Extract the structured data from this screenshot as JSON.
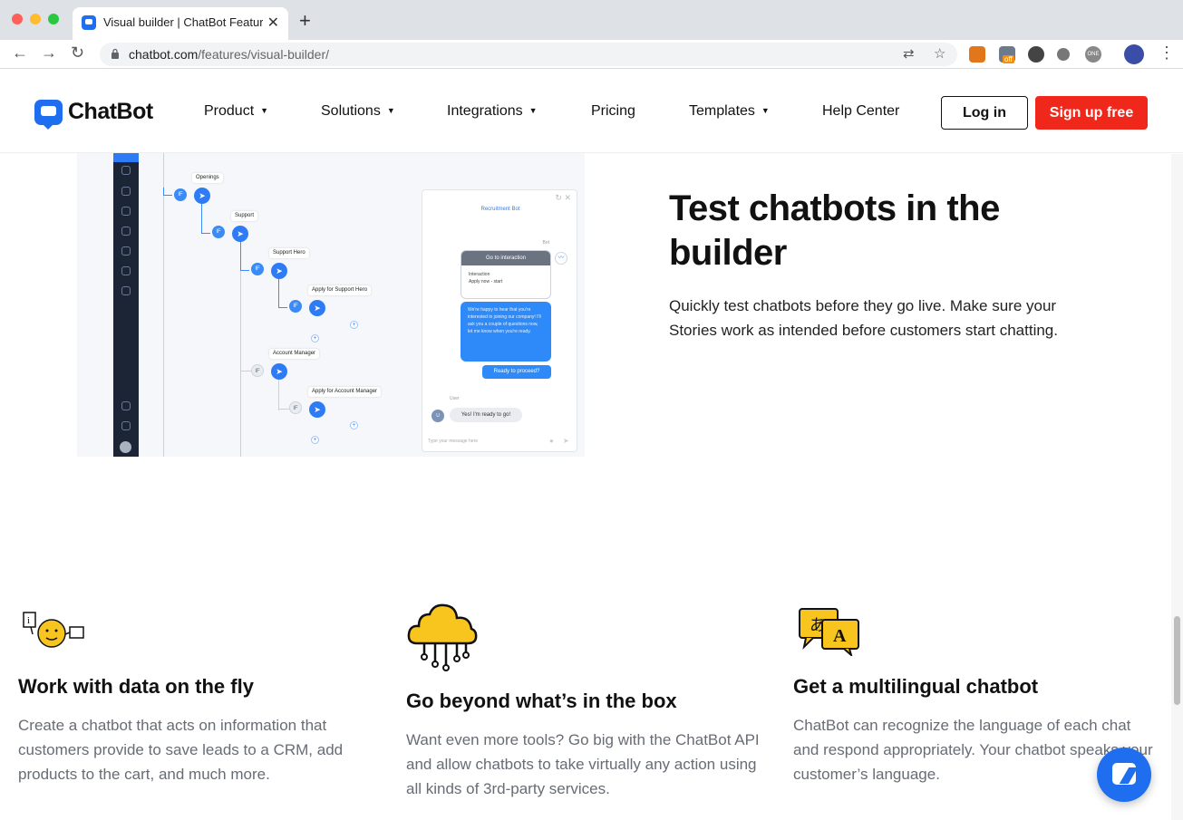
{
  "browser": {
    "tab_title": "Visual builder | ChatBot Features",
    "url_domain": "chatbot.com",
    "url_path": "/features/visual-builder/",
    "extension_badge": "off",
    "extension_one": "ONE"
  },
  "header": {
    "logo_text": "ChatBot",
    "brand_color": "#1f6ef0",
    "menu": [
      {
        "label": "Product",
        "has_dropdown": true
      },
      {
        "label": "Solutions",
        "has_dropdown": true
      },
      {
        "label": "Integrations",
        "has_dropdown": true
      },
      {
        "label": "Pricing",
        "has_dropdown": false
      },
      {
        "label": "Templates",
        "has_dropdown": true
      },
      {
        "label": "Help Center",
        "has_dropdown": false
      }
    ],
    "login_label": "Log in",
    "signup_label": "Sign up free",
    "signup_color": "#f0281b"
  },
  "builder": {
    "nodes": {
      "openings": "Openings",
      "support": "Support",
      "support_hero": "Support Hero",
      "apply_support_hero": "Apply for Support Hero",
      "account_manager": "Account Manager",
      "apply_account_manager": "Apply for Account Manager",
      "if_label": "IF"
    },
    "chat": {
      "title": "Recruitment Bot",
      "bot_label": "Bot",
      "card_header": "Go to interaction",
      "card_line1": "Interaction",
      "card_line2": "Apply now - start",
      "bot_message": "We're happy to hear that you're interested in joining our company! I'll ask you a couple of questions now, let me know when you're ready.",
      "quick_reply": "Ready to proceed?",
      "user_label": "User",
      "user_initial": "U",
      "user_message": "Yes! I'm ready to go!",
      "input_placeholder": "Type your message here"
    }
  },
  "hero": {
    "title": "Test chatbots in the builder",
    "description": "Quickly test chatbots before they go live. Make sure your Stories work as intended before customers start chatting."
  },
  "features": [
    {
      "icon": "smiley-data-icon",
      "title": "Work with data on the fly",
      "description": "Create a chatbot that acts on information that customers provide to save leads to a CRM, add products to the cart, and much more."
    },
    {
      "icon": "cloud-circuit-icon",
      "title": "Go beyond what’s in the box",
      "description": "Want even more tools? Go big with the ChatBot API and allow chatbots to take virtually any action using all kinds of 3rd-party services."
    },
    {
      "icon": "translate-bubbles-icon",
      "title": "Get a multilingual chatbot",
      "description": "ChatBot can recognize the language of each chat and respond appropriately. Your chatbot speaks your customer’s language."
    }
  ]
}
